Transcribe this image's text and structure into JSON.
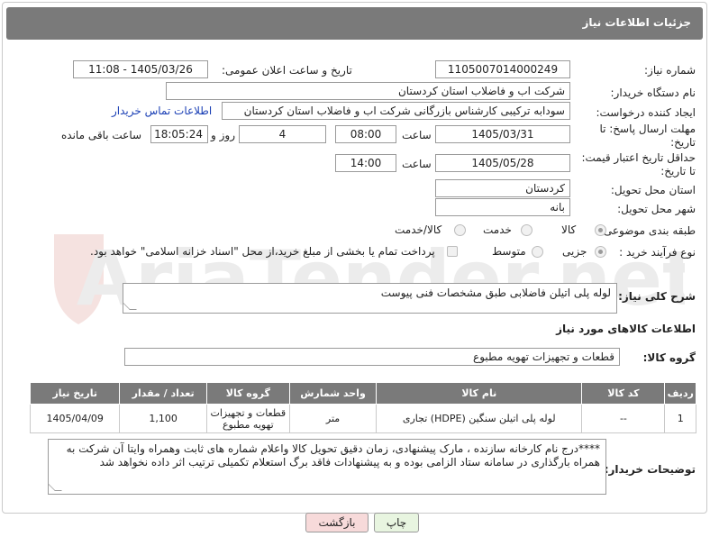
{
  "header": {
    "title": "جزئیات اطلاعات نیاز"
  },
  "form": {
    "need_number": {
      "label": "شماره نیاز:",
      "value": "1105007014000249"
    },
    "announce_datetime": {
      "label": "تاریخ و ساعت اعلان عمومی:",
      "value": "1405/03/26 - 11:08"
    },
    "buyer_org": {
      "label": "نام دستگاه خریدار:",
      "value": "شرکت اب و فاضلاب استان کردستان"
    },
    "requester": {
      "label": "ایجاد کننده درخواست:",
      "value": "سودابه ترکیبی کارشناس بازرگانی شرکت اب و فاضلاب استان کردستان",
      "contact_link": "اطلاعات تماس خریدار"
    },
    "reply_deadline": {
      "label_line1": "مهلت ارسال پاسخ: تا",
      "label_line2": "تاریخ:",
      "date": "1405/03/31",
      "time_label": "ساعت",
      "time": "08:00",
      "days": "4",
      "days_label": "روز و",
      "remaining": "18:05:24",
      "remaining_label": "ساعت باقی مانده"
    },
    "price_validity": {
      "label_line1": "حداقل تاریخ اعتبار قیمت:",
      "label_line2": "تا تاریخ:",
      "date": "1405/05/28",
      "time_label": "ساعت",
      "time": "14:00"
    },
    "delivery_province": {
      "label": "استان محل تحویل:",
      "value": "کردستان"
    },
    "delivery_city": {
      "label": "شهر محل تحویل:",
      "value": "بانه"
    },
    "category": {
      "label": "طبقه بندی موضوعی:",
      "options": [
        "کالا",
        "خدمت",
        "کالا/خدمت"
      ],
      "selected": "کالا"
    },
    "process_type": {
      "label": "نوع فرآیند خرید :",
      "options": [
        "جزیی",
        "متوسط"
      ],
      "selected": "جزیی",
      "payment_note": "پرداخت تمام یا بخشی از مبلغ خرید،از محل \"اسناد خزانه اسلامی\" خواهد بود."
    },
    "description": {
      "label": "شرح کلی نیاز:",
      "value": "لوله پلی اتیلن فاضلابی طبق مشخصات فنی پیوست"
    }
  },
  "goods_info": {
    "section_title": "اطلاعات کالاهای مورد نیاز",
    "group_label": "گروه کالا:",
    "group_value": "قطعات و تجهیزات تهویه مطبوع"
  },
  "table": {
    "headers": [
      "ردیف",
      "کد کالا",
      "نام کالا",
      "واحد شمارش",
      "گروه کالا",
      "تعداد / مقدار",
      "تاریخ نیاز"
    ],
    "rows": [
      [
        "1",
        "--",
        "لوله پلی اتیلن سنگین (HDPE) تجاری",
        "متر",
        "قطعات و تجهیزات تهویه مطبوع",
        "1,100",
        "1405/04/09"
      ]
    ]
  },
  "buyer_notes": {
    "label": "توضیحات خریدار:",
    "value": "****درج نام کارخانه سازنده ، مارک پیشنهادی، زمان دقیق تحویل کالا واعلام شماره های ثابت وهمراه وایتا آن شرکت به همراه بارگذاری در سامانه ستاد الزامی بوده و به پیشنهادات فاقد برگ استعلام تکمیلی ترتیب اثر داده نخواهد شد"
  },
  "buttons": {
    "print": "چاپ",
    "back": "بازگشت"
  },
  "watermark": {
    "text": "AriaTender.net"
  },
  "colors": {
    "header_bg": "#7a7a7a",
    "link": "#1a3fb5",
    "back_button_bg": "#f7dada",
    "print_button_bg": "#e8f5e0"
  }
}
